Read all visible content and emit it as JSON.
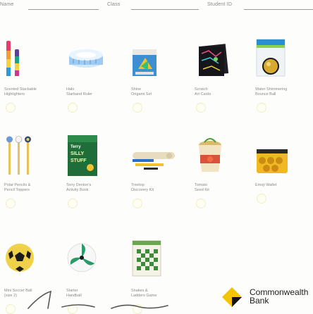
{
  "header": {
    "fields": [
      {
        "label": "Name"
      },
      {
        "label": "Class"
      },
      {
        "label": "Student ID"
      }
    ]
  },
  "items": [
    {
      "caption": "Scented Stackable\nHighlighters",
      "icon": "highlighters-icon"
    },
    {
      "caption": "Halo\nStarband Ruler",
      "icon": "ruler-icon"
    },
    {
      "caption": "Shine\nOrigami Set",
      "icon": "origami-set-icon"
    },
    {
      "caption": "Scratch\nArt Cards",
      "icon": "scratch-cards-icon"
    },
    {
      "caption": "Water Shimmering\nBounce Ball",
      "icon": "bounce-ball-icon"
    },
    {
      "caption": "Polar Pencils &\nPencil Toppers",
      "icon": "pencil-toppers-icon"
    },
    {
      "caption": "Terry Denton's\nActivity Book",
      "icon": "activity-book-icon"
    },
    {
      "caption": "Treetop\nDiscovery Kit",
      "icon": "discovery-kit-icon"
    },
    {
      "caption": "Tomato\nSeed Kit",
      "icon": "seed-kit-icon"
    },
    {
      "caption": "Emoji Wallet",
      "icon": "wallet-icon"
    },
    {
      "caption": "Mini Soccer Ball\n(size 2)",
      "icon": "soccer-ball-icon"
    },
    {
      "caption": "Starter\nHandball",
      "icon": "handball-icon"
    },
    {
      "caption": "Snakes &\nLadders Game",
      "icon": "board-game-icon"
    }
  ],
  "logo": {
    "name": "Commonwealth",
    "sub": "Bank",
    "icon": "commonwealth-bank-logo-icon"
  },
  "colors": {
    "brand_yellow": "#f5c400",
    "brand_black": "#111111",
    "line": "#9a9a9a"
  }
}
